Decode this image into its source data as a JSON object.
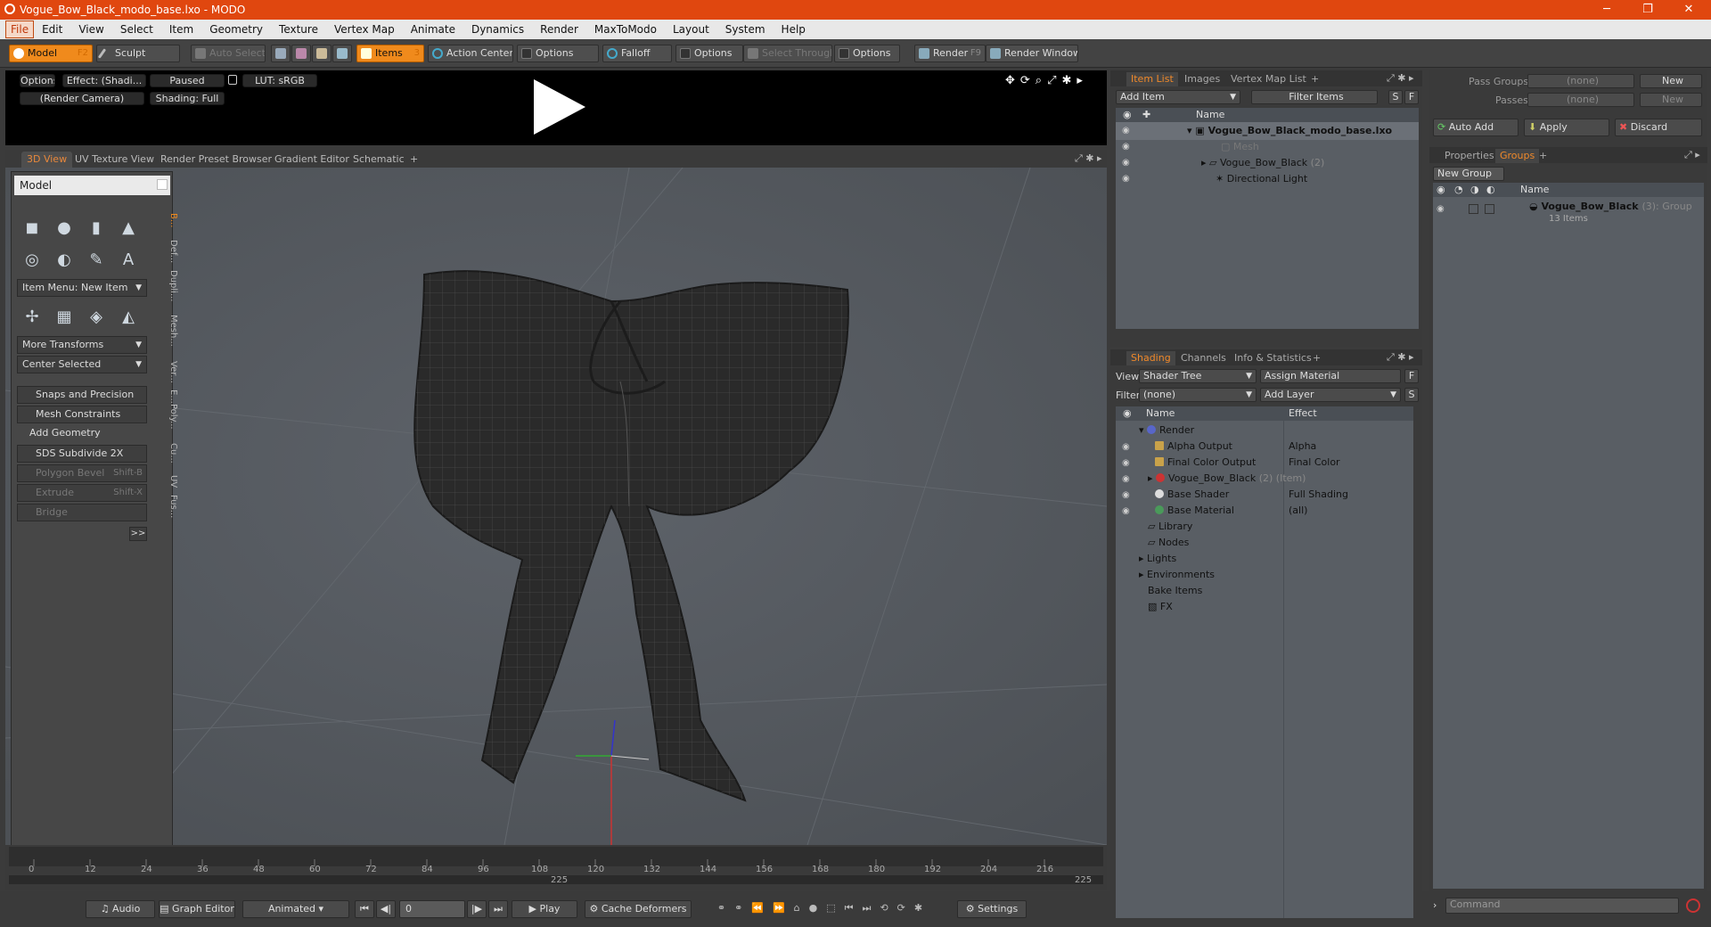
{
  "window": {
    "title": "Vogue_Bow_Black_modo_base.lxo - MODO",
    "minimize": "─",
    "maximize": "❐",
    "close": "✕"
  },
  "menu": [
    "File",
    "Edit",
    "View",
    "Select",
    "Item",
    "Geometry",
    "Texture",
    "Vertex Map",
    "Animate",
    "Dynamics",
    "Render",
    "MaxToModo",
    "Layout",
    "System",
    "Help"
  ],
  "toolbar": {
    "model": "Model",
    "model_key": "F2",
    "sculpt": "Sculpt",
    "auto_select": "Auto Select",
    "items": "Items",
    "items_key": "3",
    "action_center": "Action Center",
    "options1": "Options",
    "falloff": "Falloff",
    "options2": "Options",
    "select_through": "Select Through",
    "options3": "Options",
    "render": "Render",
    "render_key": "F9",
    "render_window": "Render Window"
  },
  "preview": {
    "options": "Options",
    "effect": "Effect: (Shadi...",
    "paused": "Paused",
    "lut": "LUT: sRGB",
    "camera": "(Render Camera)",
    "shading": "Shading: Full"
  },
  "view_tabs": [
    "3D View",
    "UV Texture View",
    "Render Preset Browser",
    "Gradient Editor",
    "Schematic",
    "+"
  ],
  "toolpanel": {
    "title": "Model",
    "item_menu": "Item Menu: New Item",
    "more_transforms": "More Transforms",
    "center_selected": "Center Selected",
    "snaps": "Snaps and Precision",
    "mesh_constraints": "Mesh Constraints",
    "add_geometry": "Add Geometry",
    "sds": "SDS Subdivide 2X",
    "polygon_bevel": "Polygon Bevel",
    "polygon_bevel_key": "Shift-B",
    "extrude": "Extrude",
    "extrude_key": "Shift-X",
    "bridge": "Bridge",
    "more": ">>",
    "vtabs": [
      "B...",
      "Def...",
      "Dupli...",
      "Mesh...",
      "Ver...",
      "E...",
      "Poly...",
      "Cu...",
      "UV",
      "Fus..."
    ]
  },
  "timeline": {
    "ticks": [
      "0",
      "12",
      "24",
      "36",
      "48",
      "60",
      "72",
      "84",
      "96",
      "108",
      "120",
      "132",
      "144",
      "156",
      "168",
      "180",
      "192",
      "204",
      "216"
    ],
    "end": "225",
    "mid": "225"
  },
  "bottombar": {
    "audio": "Audio",
    "graph_editor": "Graph Editor",
    "animated": "Animated",
    "frame": "0",
    "play": "Play",
    "cache": "Cache Deformers",
    "settings": "Settings"
  },
  "itemlist": {
    "tabs": [
      "Item List",
      "Images",
      "Vertex Map List",
      "+"
    ],
    "add_item": "Add Item",
    "filter_items": "Filter Items",
    "s": "S",
    "f": "F",
    "col_name": "Name",
    "rows": [
      {
        "label": "Vogue_Bow_Black_modo_base.lxo",
        "extra": ""
      },
      {
        "label": "Mesh",
        "extra": ""
      },
      {
        "label": "Vogue_Bow_Black",
        "extra": "(2)"
      },
      {
        "label": "Directional Light",
        "extra": ""
      }
    ]
  },
  "shading": {
    "tabs": [
      "Shading",
      "Channels",
      "Info & Statistics",
      "+"
    ],
    "view_label": "View",
    "view_value": "Shader Tree",
    "assign_material": "Assign Material",
    "f": "F",
    "filter_label": "Filter",
    "filter_value": "(none)",
    "add_layer": "Add Layer",
    "s": "S",
    "col_name": "Name",
    "col_effect": "Effect",
    "rows": [
      {
        "label": "Render",
        "effect": ""
      },
      {
        "label": "Alpha Output",
        "effect": "Alpha"
      },
      {
        "label": "Final Color Output",
        "effect": "Final Color"
      },
      {
        "label": "Vogue_Bow_Black",
        "extra": "(2) (Item)",
        "effect": ""
      },
      {
        "label": "Base Shader",
        "effect": "Full Shading"
      },
      {
        "label": "Base Material",
        "effect": "(all)"
      },
      {
        "label": "Library",
        "effect": ""
      },
      {
        "label": "Nodes",
        "effect": ""
      },
      {
        "label": "Lights",
        "effect": ""
      },
      {
        "label": "Environments",
        "effect": ""
      },
      {
        "label": "Bake Items",
        "effect": ""
      },
      {
        "label": "FX",
        "effect": ""
      }
    ]
  },
  "groups": {
    "pass_groups": "Pass Groups",
    "pass_groups_val": "(none)",
    "new": "New",
    "passes": "Passes",
    "passes_val": "(none)",
    "new2": "New",
    "auto_add": "Auto Add",
    "apply": "Apply",
    "discard": "Discard",
    "tabs": [
      "Properties",
      "Groups",
      "+"
    ],
    "new_group": "New Group",
    "col_name": "Name",
    "group_name": "Vogue_Bow_Black",
    "group_count": "(3)",
    "group_type": ": Group",
    "group_items": "13 Items",
    "command": "Command"
  }
}
